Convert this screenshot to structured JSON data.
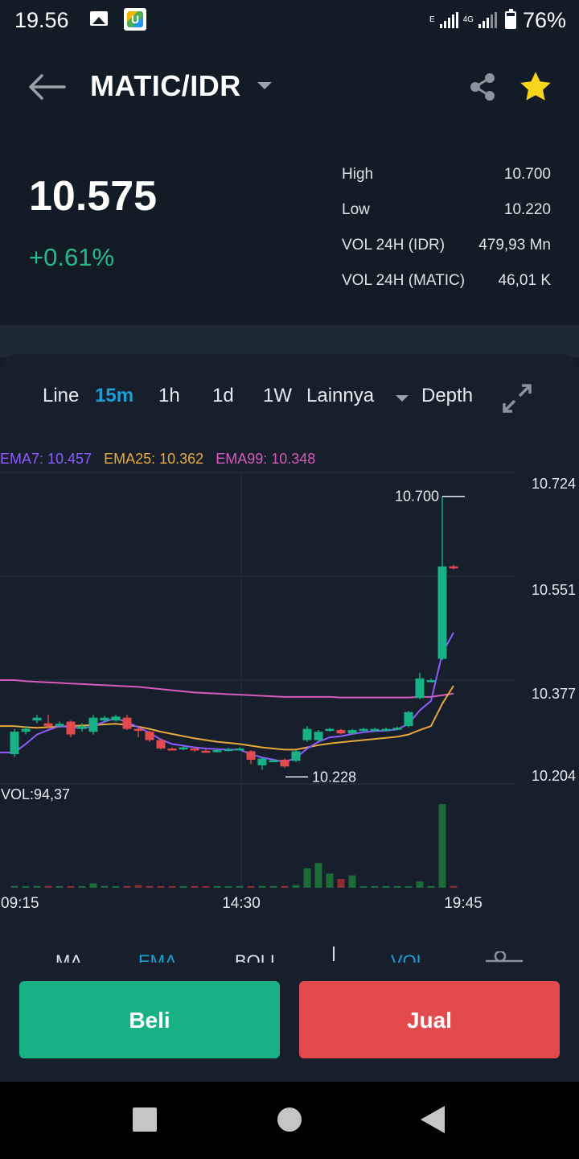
{
  "status_bar": {
    "time": "19.56",
    "network_e": "E",
    "network_4g": "4G",
    "battery": "76%",
    "icons": [
      "image-icon",
      "app-icon",
      "signal-icon",
      "signal-icon",
      "battery-icon"
    ]
  },
  "header": {
    "pair": "MATIC/IDR",
    "icons": [
      "back-arrow-icon",
      "dropdown-caret-icon",
      "share-icon",
      "star-icon"
    ]
  },
  "ticker": {
    "price": "10.575",
    "change": "+0.61%",
    "stats": [
      {
        "label": "High",
        "value": "10.700"
      },
      {
        "label": "Low",
        "value": "10.220"
      },
      {
        "label": "VOL 24H (IDR)",
        "value": "479,93 Mn"
      },
      {
        "label": "VOL 24H (MATIC)",
        "value": "46,01 K"
      }
    ]
  },
  "chart_tabs": {
    "items": [
      "Line",
      "15m",
      "1h",
      "1d",
      "1W",
      "Lainnya",
      "Depth"
    ],
    "active": "15m",
    "icons": [
      "expand-icon"
    ]
  },
  "ema_legend": {
    "ema7": "EMA7: 10.457",
    "ema25": "EMA25: 10.362",
    "ema99": "EMA99: 10.348"
  },
  "chart_data": {
    "type": "candlestick",
    "y_ticks": [
      "10.724",
      "10.551",
      "10.377",
      "10.204"
    ],
    "ylim": [
      10.204,
      10.724
    ],
    "x_ticks": [
      "09:15",
      "14:30",
      "19:45"
    ],
    "high_marker": "10.700",
    "low_marker": "10.228",
    "volume_label": "VOL:94,37",
    "colors": {
      "up": "#17b185",
      "down": "#e24a4d",
      "ema7": "#8e5cff",
      "ema25": "#e7a93b",
      "ema99": "#d75bb9"
    },
    "candles": [
      {
        "o": 10.24,
        "c": 10.28,
        "h": 10.285,
        "l": 10.235
      },
      {
        "o": 10.28,
        "c": 10.285,
        "h": 10.29,
        "l": 10.275
      },
      {
        "o": 10.3,
        "c": 10.305,
        "h": 10.31,
        "l": 10.295
      },
      {
        "o": 10.295,
        "c": 10.29,
        "h": 10.31,
        "l": 10.285
      },
      {
        "o": 10.292,
        "c": 10.294,
        "h": 10.298,
        "l": 10.288
      },
      {
        "o": 10.298,
        "c": 10.275,
        "h": 10.3,
        "l": 10.27
      },
      {
        "o": 10.285,
        "c": 10.29,
        "h": 10.295,
        "l": 10.28
      },
      {
        "o": 10.28,
        "c": 10.305,
        "h": 10.31,
        "l": 10.275
      },
      {
        "o": 10.3,
        "c": 10.305,
        "h": 10.308,
        "l": 10.297
      },
      {
        "o": 10.3,
        "c": 10.307,
        "h": 10.31,
        "l": 10.298
      },
      {
        "o": 10.305,
        "c": 10.285,
        "h": 10.31,
        "l": 10.283
      },
      {
        "o": 10.285,
        "c": 10.283,
        "h": 10.288,
        "l": 10.27
      },
      {
        "o": 10.28,
        "c": 10.265,
        "h": 10.282,
        "l": 10.262
      },
      {
        "o": 10.265,
        "c": 10.25,
        "h": 10.268,
        "l": 10.248
      },
      {
        "o": 10.25,
        "c": 10.249,
        "h": 10.252,
        "l": 10.247
      },
      {
        "o": 10.249,
        "c": 10.252,
        "h": 10.254,
        "l": 10.247
      },
      {
        "o": 10.25,
        "c": 10.248,
        "h": 10.252,
        "l": 10.244
      },
      {
        "o": 10.246,
        "c": 10.245,
        "h": 10.248,
        "l": 10.243
      },
      {
        "o": 10.245,
        "c": 10.247,
        "h": 10.249,
        "l": 10.243
      },
      {
        "o": 10.247,
        "c": 10.249,
        "h": 10.251,
        "l": 10.245
      },
      {
        "o": 10.249,
        "c": 10.25,
        "h": 10.252,
        "l": 10.247
      },
      {
        "o": 10.245,
        "c": 10.23,
        "h": 10.247,
        "l": 10.222
      },
      {
        "o": 10.22,
        "c": 10.232,
        "h": 10.234,
        "l": 10.212
      },
      {
        "o": 10.228,
        "c": 10.229,
        "h": 10.231,
        "l": 10.227
      },
      {
        "o": 10.23,
        "c": 10.218,
        "h": 10.232,
        "l": 10.215
      },
      {
        "o": 10.228,
        "c": 10.245,
        "h": 10.247,
        "l": 10.226
      },
      {
        "o": 10.265,
        "c": 10.285,
        "h": 10.29,
        "l": 10.262
      },
      {
        "o": 10.265,
        "c": 10.28,
        "h": 10.283,
        "l": 10.263
      },
      {
        "o": 10.283,
        "c": 10.285,
        "h": 10.287,
        "l": 10.28
      },
      {
        "o": 10.283,
        "c": 10.277,
        "h": 10.285,
        "l": 10.275
      },
      {
        "o": 10.277,
        "c": 10.283,
        "h": 10.285,
        "l": 10.275
      },
      {
        "o": 10.283,
        "c": 10.285,
        "h": 10.287,
        "l": 10.28
      },
      {
        "o": 10.283,
        "c": 10.285,
        "h": 10.287,
        "l": 10.28
      },
      {
        "o": 10.283,
        "c": 10.285,
        "h": 10.287,
        "l": 10.281
      },
      {
        "o": 10.285,
        "c": 10.287,
        "h": 10.289,
        "l": 10.283
      },
      {
        "o": 10.29,
        "c": 10.315,
        "h": 10.317,
        "l": 10.288
      },
      {
        "o": 10.34,
        "c": 10.375,
        "h": 10.385,
        "l": 10.338
      },
      {
        "o": 10.37,
        "c": 10.372,
        "h": 10.375,
        "l": 10.368
      },
      {
        "o": 10.41,
        "c": 10.575,
        "h": 10.7,
        "l": 10.408
      },
      {
        "o": 10.575,
        "c": 10.573,
        "h": 10.578,
        "l": 10.57
      }
    ],
    "ema7": [
      10.243,
      10.258,
      10.275,
      10.283,
      10.29,
      10.288,
      10.286,
      10.29,
      10.298,
      10.304,
      10.297,
      10.288,
      10.278,
      10.266,
      10.258,
      10.255,
      10.252,
      10.25,
      10.249,
      10.248,
      10.248,
      10.24,
      10.234,
      10.23,
      10.226,
      10.233,
      10.25,
      10.262,
      10.27,
      10.272,
      10.276,
      10.279,
      10.281,
      10.282,
      10.284,
      10.294,
      10.318,
      10.335,
      10.42,
      10.457
    ],
    "ema25": [
      10.29,
      10.288,
      10.287,
      10.288,
      10.289,
      10.29,
      10.291,
      10.292,
      10.293,
      10.294,
      10.292,
      10.289,
      10.285,
      10.28,
      10.276,
      10.272,
      10.268,
      10.265,
      10.262,
      10.26,
      10.258,
      10.255,
      10.252,
      10.25,
      10.248,
      10.248,
      10.252,
      10.256,
      10.259,
      10.261,
      10.263,
      10.265,
      10.267,
      10.269,
      10.271,
      10.275,
      10.283,
      10.29,
      10.33,
      10.362
    ],
    "ema99": [
      10.372,
      10.37,
      10.369,
      10.368,
      10.367,
      10.366,
      10.365,
      10.364,
      10.363,
      10.362,
      10.361,
      10.36,
      10.358,
      10.356,
      10.354,
      10.352,
      10.35,
      10.349,
      10.348,
      10.347,
      10.346,
      10.345,
      10.344,
      10.343,
      10.342,
      10.342,
      10.342,
      10.342,
      10.342,
      10.341,
      10.341,
      10.341,
      10.341,
      10.341,
      10.341,
      10.341,
      10.342,
      10.342,
      10.345,
      10.348
    ],
    "volumes": [
      2,
      1,
      2,
      2,
      1,
      2,
      1,
      5,
      2,
      1,
      2,
      3,
      2,
      2,
      1,
      1,
      2,
      1,
      1,
      1,
      2,
      2,
      2,
      2,
      2,
      3,
      22,
      28,
      16,
      10,
      14,
      1,
      1,
      2,
      1,
      1,
      7,
      2,
      94.37,
      2
    ],
    "vol_max": 100
  },
  "indicators": {
    "items": [
      "MA",
      "EMA",
      "BOLL",
      "VOL"
    ],
    "active": [
      "EMA",
      "VOL"
    ],
    "icons": [
      "indicator-settings-icon"
    ]
  },
  "actions": {
    "buy": "Beli",
    "sell": "Jual"
  },
  "nav_bar": {
    "icons": [
      "recent-apps-icon",
      "home-icon",
      "back-icon"
    ]
  }
}
